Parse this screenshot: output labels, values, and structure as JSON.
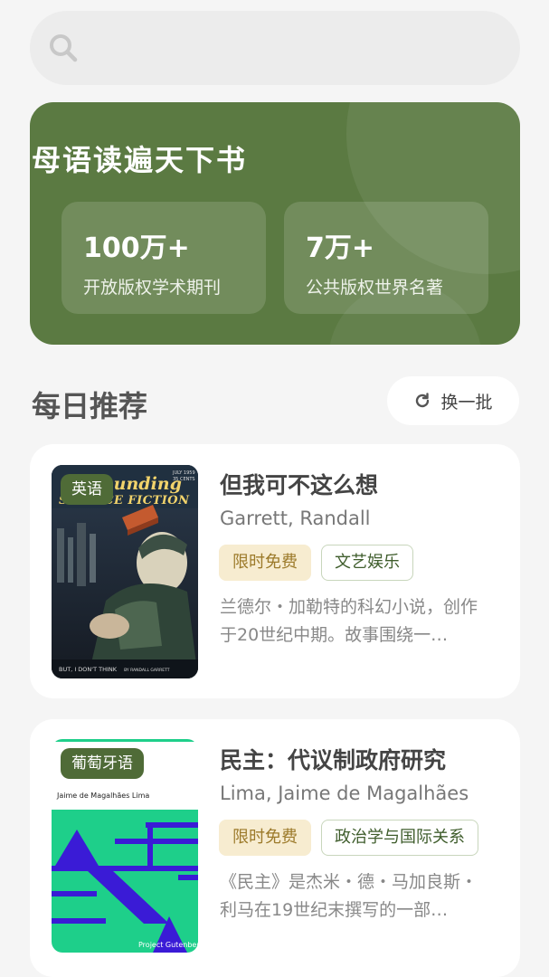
{
  "search": {
    "icon": "search-icon"
  },
  "hero": {
    "title": "母语读遍天下书",
    "stats": [
      {
        "value": "100万+",
        "label": "开放版权学术期刊"
      },
      {
        "value": "7万+",
        "label": "公共版权世界名著"
      }
    ]
  },
  "daily": {
    "title": "每日推荐",
    "refresh_label": "换一批",
    "refresh_icon": "refresh-icon"
  },
  "books": [
    {
      "language": "英语",
      "title": "但我可不这么想",
      "author": "Garrett, Randall",
      "badge": "限时免费",
      "category": "文艺娱乐",
      "description": "兰德尔・加勒特的科幻小说，创作于20世纪中期。故事围绕一…",
      "cover": {
        "brand": "ounding",
        "series": "SCIENCE FICTION",
        "issue_line1": "JULY 1959",
        "issue_line2": "35 CENTS",
        "footer": "BUT, I DON'T THINK",
        "footer_author": "BY RANDALL GARRETT"
      }
    },
    {
      "language": "葡萄牙语",
      "title": "民主：代议制政府研究",
      "author": "Lima, Jaime de Magalhães",
      "badge": "限时免费",
      "category": "政治学与国际关系",
      "description": "《民主》是杰米・德・马加良斯・利马在19世纪末撰写的一部…",
      "cover": {
        "author": "Jaime de Magalhães Lima",
        "footer": "Project Gutenberg",
        "accent": "#1ecf8a"
      }
    }
  ],
  "colors": {
    "hero_bg": "#5b7a42",
    "tag_green": "#4f6b37",
    "free_bg": "#f7ecd0",
    "free_text": "#9c7a2a"
  }
}
